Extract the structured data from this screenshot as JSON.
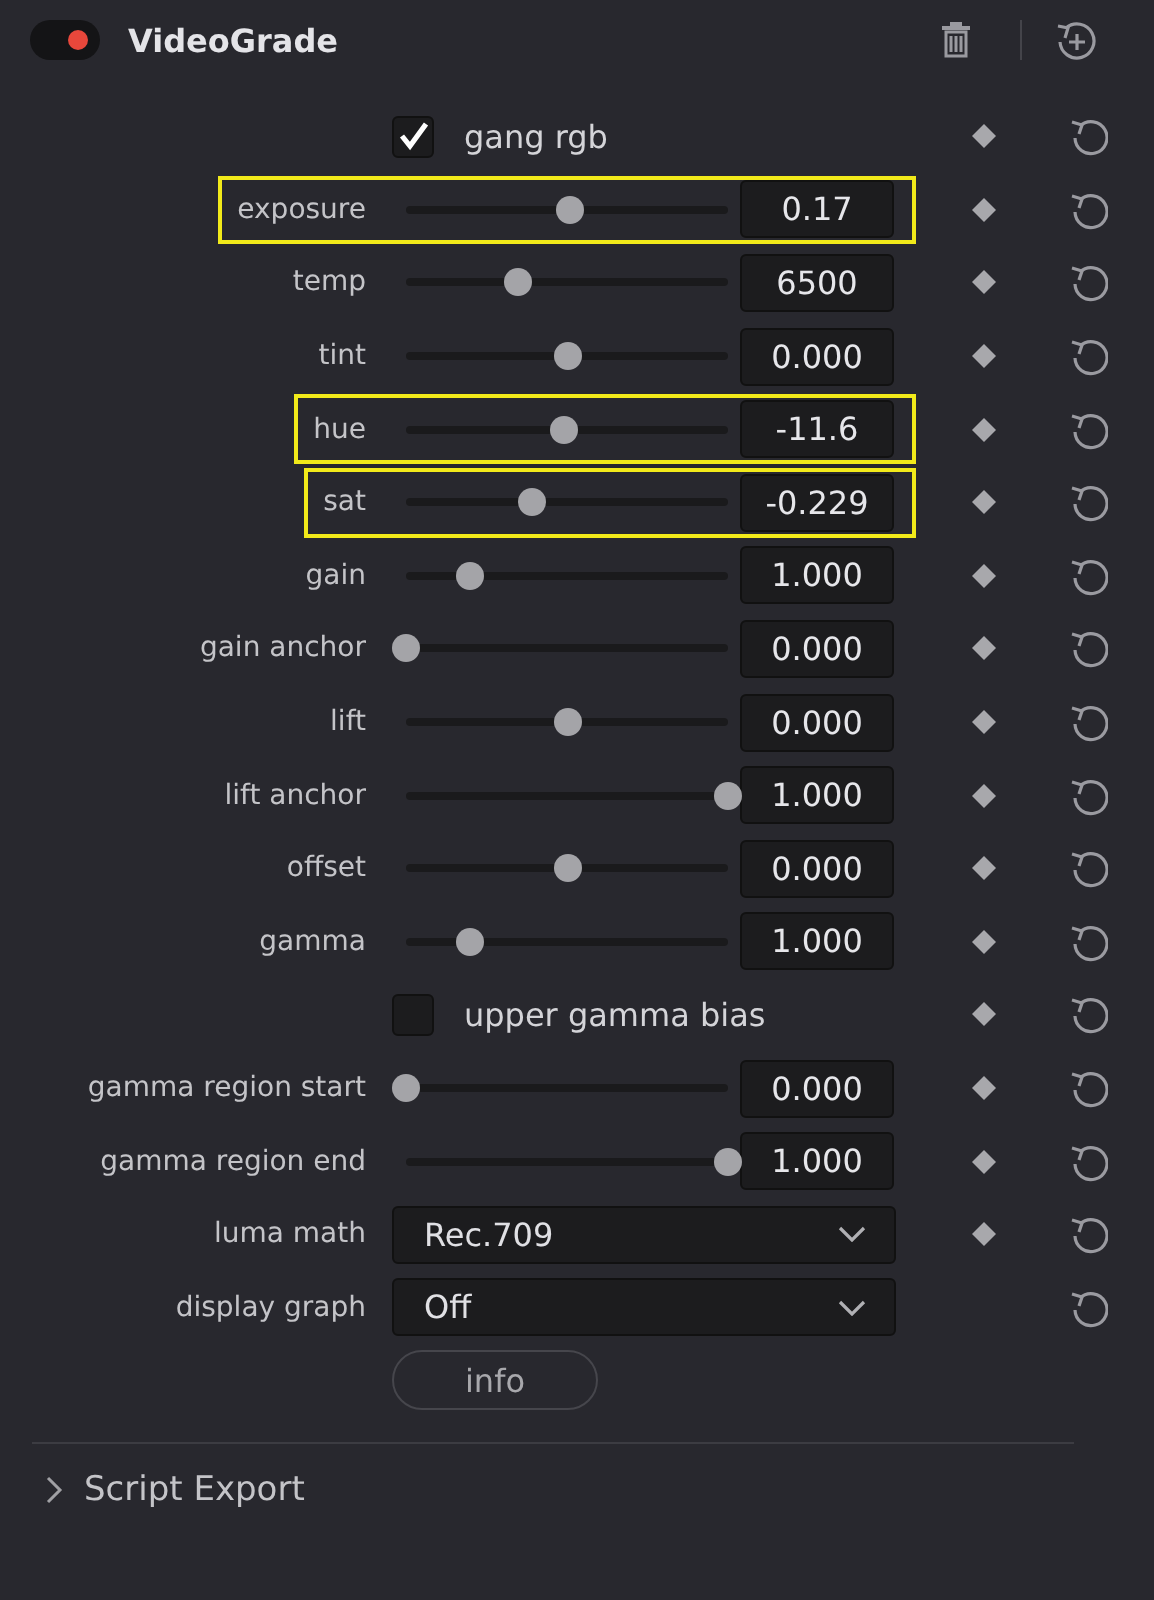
{
  "header": {
    "title": "VideoGrade",
    "enabled": true
  },
  "rows": [
    {
      "kind": "checkbox",
      "label": "gang rgb",
      "checked": true,
      "keyframe": true,
      "highlighted": false
    },
    {
      "kind": "slider",
      "label": "exposure",
      "level": 0.51,
      "value": "0.17",
      "keyframe": true,
      "highlighted": true
    },
    {
      "kind": "slider",
      "label": "temp",
      "level": 0.35,
      "value": "6500",
      "keyframe": true,
      "highlighted": false
    },
    {
      "kind": "slider",
      "label": "tint",
      "level": 0.5,
      "value": "0.000",
      "keyframe": true,
      "highlighted": false
    },
    {
      "kind": "slider",
      "label": "hue",
      "level": 0.49,
      "value": "-11.6",
      "keyframe": true,
      "highlighted": true
    },
    {
      "kind": "slider",
      "label": "sat",
      "level": 0.39,
      "value": "-0.229",
      "keyframe": true,
      "highlighted": true
    },
    {
      "kind": "slider",
      "label": "gain",
      "level": 0.2,
      "value": "1.000",
      "keyframe": true,
      "highlighted": false
    },
    {
      "kind": "slider",
      "label": "gain anchor",
      "level": 0,
      "value": "0.000",
      "keyframe": true,
      "highlighted": false
    },
    {
      "kind": "slider",
      "label": "lift",
      "level": 0.5,
      "value": "0.000",
      "keyframe": true,
      "highlighted": false
    },
    {
      "kind": "slider",
      "label": "lift anchor",
      "level": 1,
      "value": "1.000",
      "keyframe": true,
      "highlighted": false
    },
    {
      "kind": "slider",
      "label": "offset",
      "level": 0.5,
      "value": "0.000",
      "keyframe": true,
      "highlighted": false
    },
    {
      "kind": "slider",
      "label": "gamma",
      "level": 0.2,
      "value": "1.000",
      "keyframe": true,
      "highlighted": false
    },
    {
      "kind": "checkbox",
      "label": "upper gamma bias",
      "checked": false,
      "keyframe": true,
      "highlighted": false
    },
    {
      "kind": "slider",
      "label": "gamma region start",
      "level": 0,
      "value": "0.000",
      "keyframe": true,
      "highlighted": false
    },
    {
      "kind": "slider",
      "label": "gamma region end",
      "level": 1,
      "value": "1.000",
      "keyframe": true,
      "highlighted": false
    },
    {
      "kind": "dropdown",
      "label": "luma math",
      "value": "Rec.709",
      "keyframe": true,
      "highlighted": false
    },
    {
      "kind": "dropdown",
      "label": "display graph",
      "value": "Off",
      "keyframe": false,
      "highlighted": false
    },
    {
      "kind": "button",
      "label": "info"
    }
  ],
  "sections": [
    {
      "title": "Script Export",
      "expanded": false
    }
  ]
}
